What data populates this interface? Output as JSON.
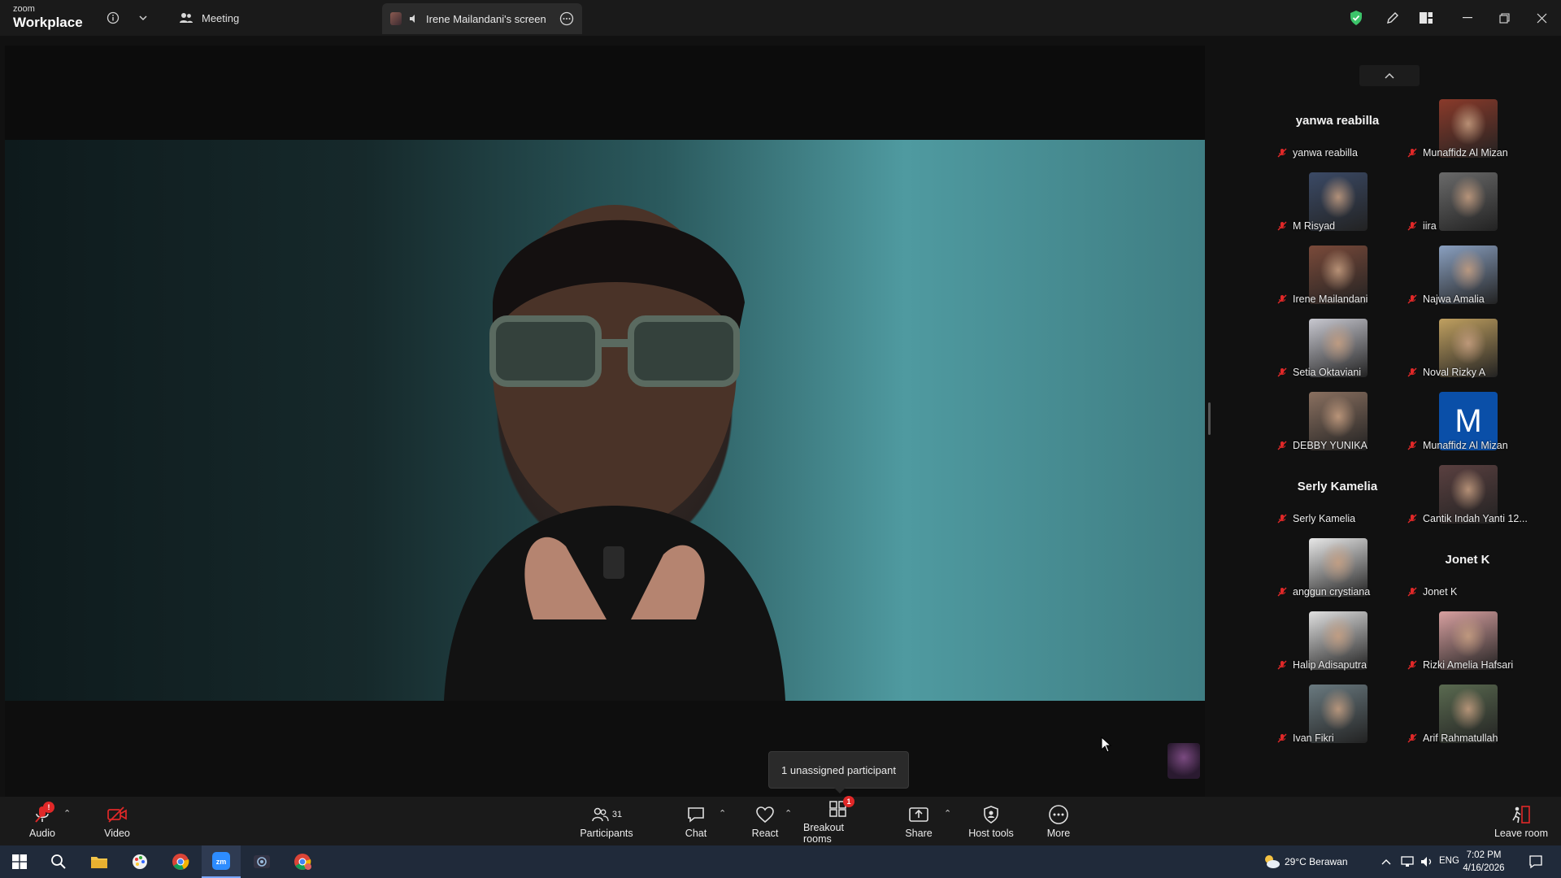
{
  "titlebar": {
    "brand_small": "zoom",
    "brand_big": "Workplace",
    "meeting_tab": "Meeting",
    "screen_tab": "Irene Mailandani's screen"
  },
  "gallery": {
    "tiles": [
      {
        "name": "yanwa reabilla",
        "display": "name",
        "bg": "#111111"
      },
      {
        "name": "Munaffidz Al Mizan",
        "display": "photo",
        "bg": "#8a3a2a"
      },
      {
        "name": "M Risyad",
        "display": "photo",
        "bg": "#3b4a66"
      },
      {
        "name": "iira",
        "display": "photo",
        "bg": "#6a6a6a"
      },
      {
        "name": "Irene Mailandani",
        "display": "photo",
        "bg": "#7a4a3a"
      },
      {
        "name": "Najwa Amalia",
        "display": "photo",
        "bg": "#8aa0c0"
      },
      {
        "name": "Setia Oktaviani",
        "display": "photo",
        "bg": "#c8c8d0"
      },
      {
        "name": "Noval Rizky A",
        "display": "photo",
        "bg": "#c0a060"
      },
      {
        "name": "DEBBY YUNIKA",
        "display": "photo",
        "bg": "#8a7060"
      },
      {
        "name": "Munaffidz Al Mizan",
        "display": "letter",
        "letter": "M",
        "bg": "#0a4fa8"
      },
      {
        "name": "Serly Kamelia",
        "display": "name",
        "bg": "#111111"
      },
      {
        "name": "Cantik Indah Yanti 12...",
        "display": "photo",
        "bg": "#5a4040"
      },
      {
        "name": "anggun crystiana",
        "display": "photo",
        "bg": "#e8e8e8"
      },
      {
        "name": "Jonet K",
        "display": "name",
        "bg": "#111111"
      },
      {
        "name": "Halip Adisaputra",
        "display": "photo",
        "bg": "#e0e0e0"
      },
      {
        "name": "Rizki Amelia Hafsari",
        "display": "photo",
        "bg": "#d8a0a0"
      },
      {
        "name": "Ivan Fikri",
        "display": "photo",
        "bg": "#6a7a80"
      },
      {
        "name": "Arif Rahmatullah",
        "display": "photo",
        "bg": "#5a6a50"
      }
    ]
  },
  "tooltip": "1 unassigned participant",
  "toolbar": {
    "audio": "Audio",
    "video": "Video",
    "participants": "Participants",
    "participant_count": "31",
    "chat": "Chat",
    "react": "React",
    "breakout": "Breakout rooms",
    "breakout_badge": "1",
    "share": "Share",
    "host_tools": "Host tools",
    "more": "More",
    "leave": "Leave room"
  },
  "taskbar": {
    "weather": "29°C  Berawan",
    "lang": "ENG",
    "time": "7:02 PM",
    "date": "4/16/2026"
  },
  "colors": {
    "muted_mic": "#e02828",
    "shield_green": "#3cc46a",
    "accent_blue": "#0a4fa8"
  }
}
